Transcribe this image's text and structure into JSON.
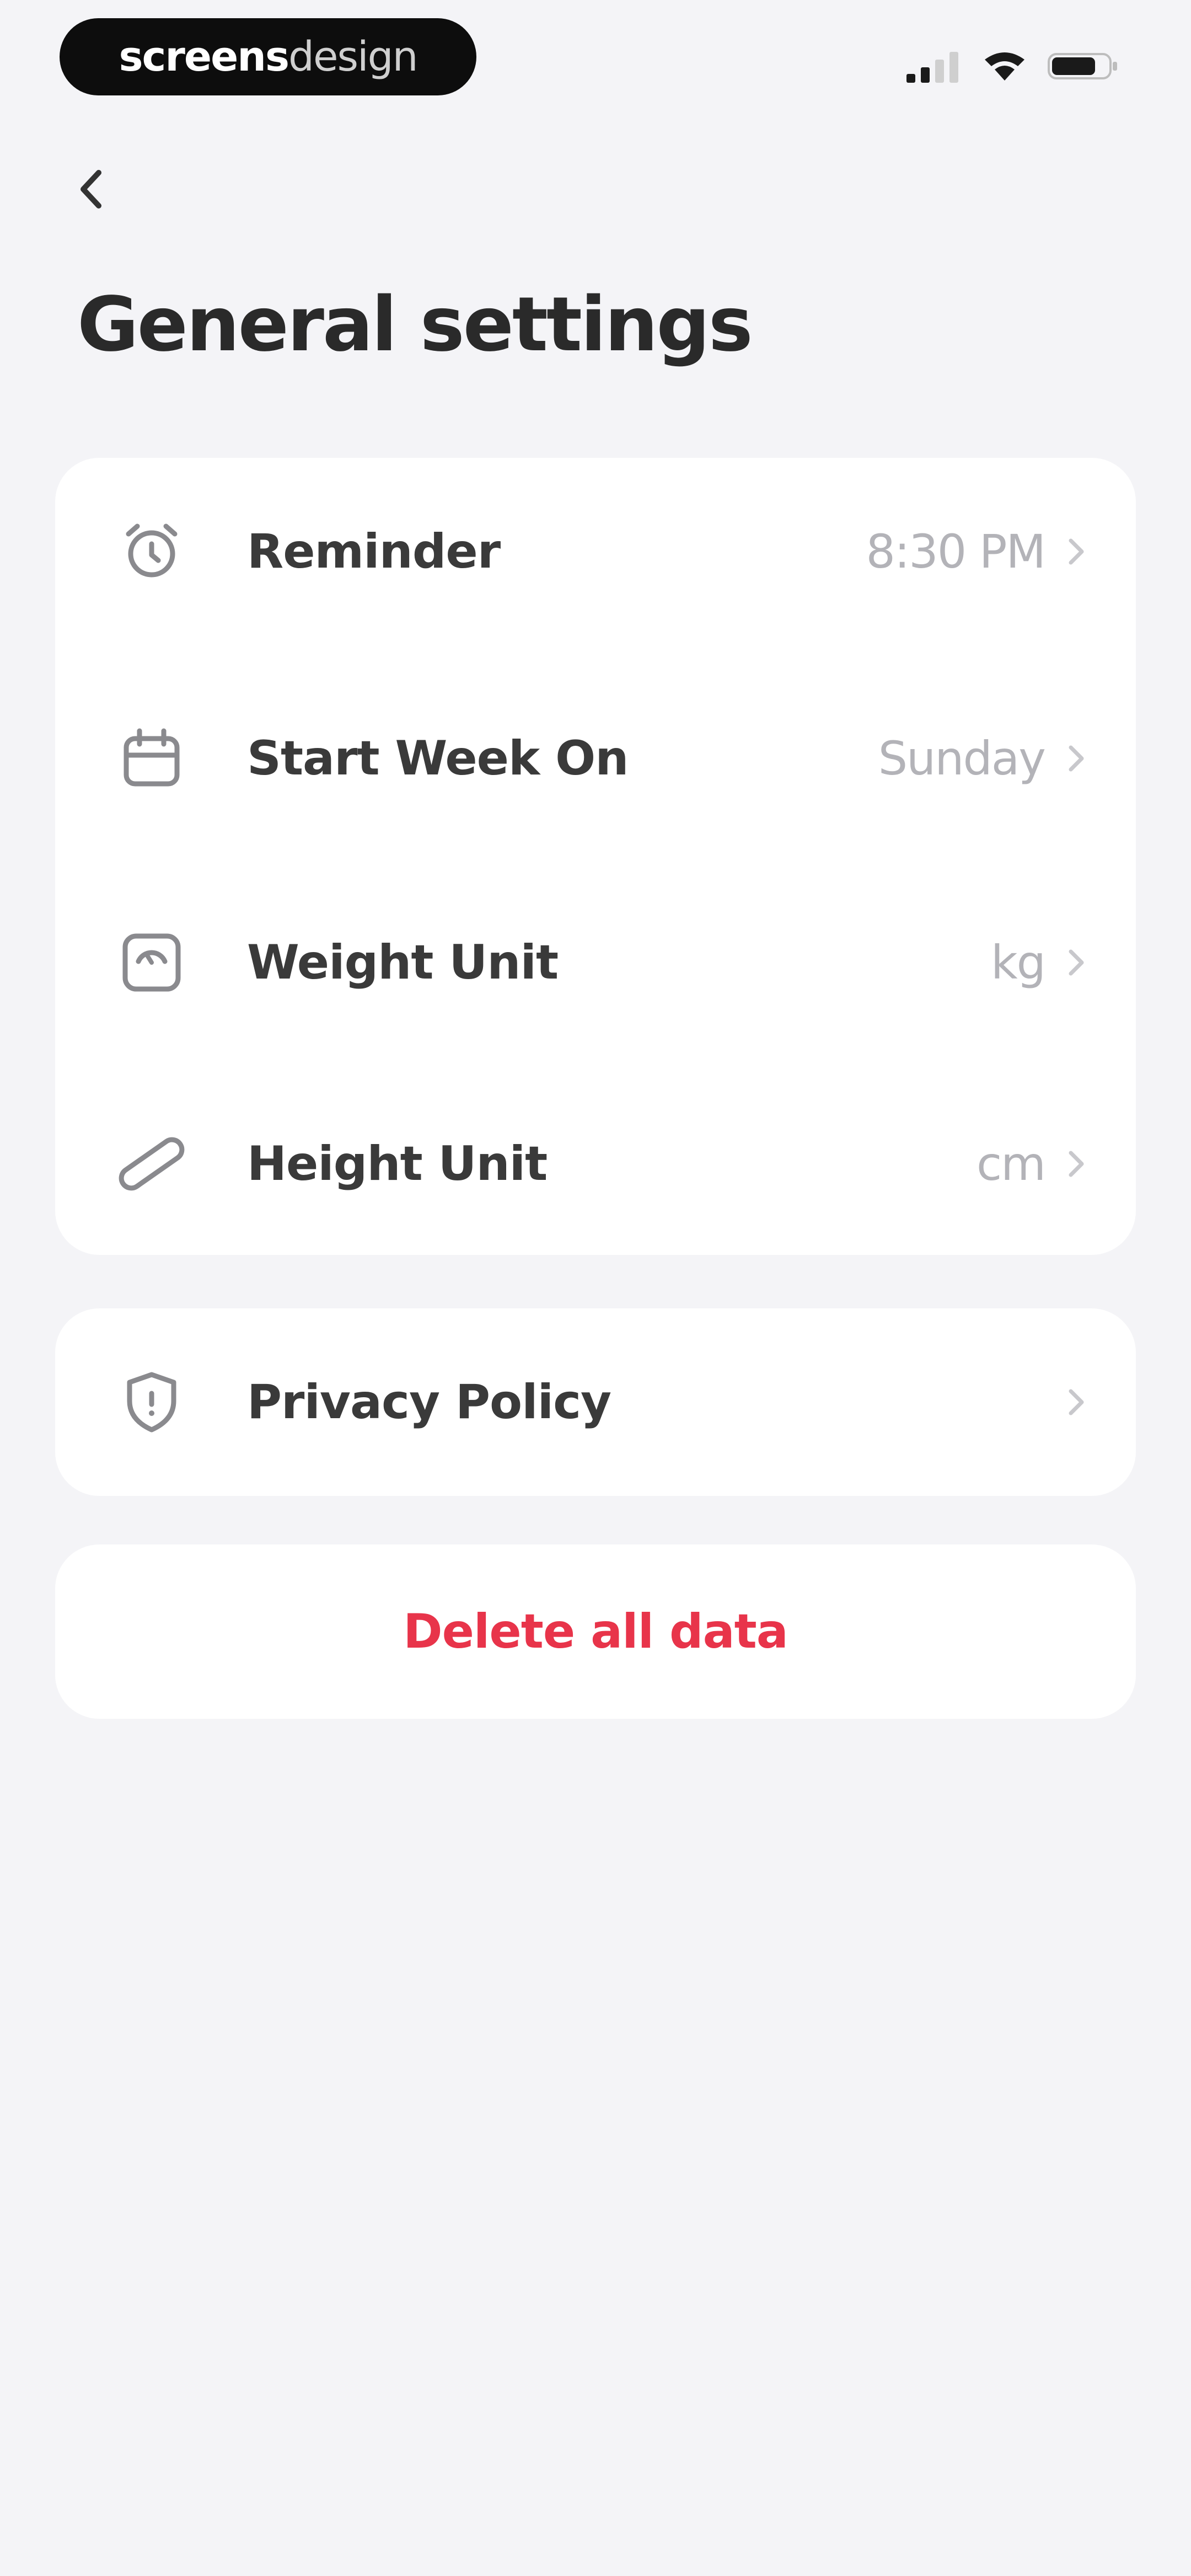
{
  "status_bar": {
    "watermark_bold": "screens",
    "watermark_light": "design",
    "icons": [
      "signal-icon",
      "wifi-icon",
      "battery-icon"
    ]
  },
  "header": {
    "back_icon": "chevron-left-icon",
    "title": "General settings"
  },
  "settings": {
    "items": [
      {
        "icon": "alarm-clock-icon",
        "label": "Reminder",
        "value": "8:30 PM"
      },
      {
        "icon": "calendar-icon",
        "label": "Start Week On",
        "value": "Sunday"
      },
      {
        "icon": "scale-icon",
        "label": "Weight Unit",
        "value": "kg"
      },
      {
        "icon": "ruler-icon",
        "label": "Height Unit",
        "value": "cm"
      }
    ]
  },
  "privacy": {
    "icon": "shield-icon",
    "label": "Privacy Policy"
  },
  "danger": {
    "delete_label": "Delete all data"
  },
  "colors": {
    "background": "#f4f4f7",
    "card": "#ffffff",
    "text_primary": "#3a3a3a",
    "text_secondary": "#b3b3b8",
    "danger": "#e8344a"
  }
}
